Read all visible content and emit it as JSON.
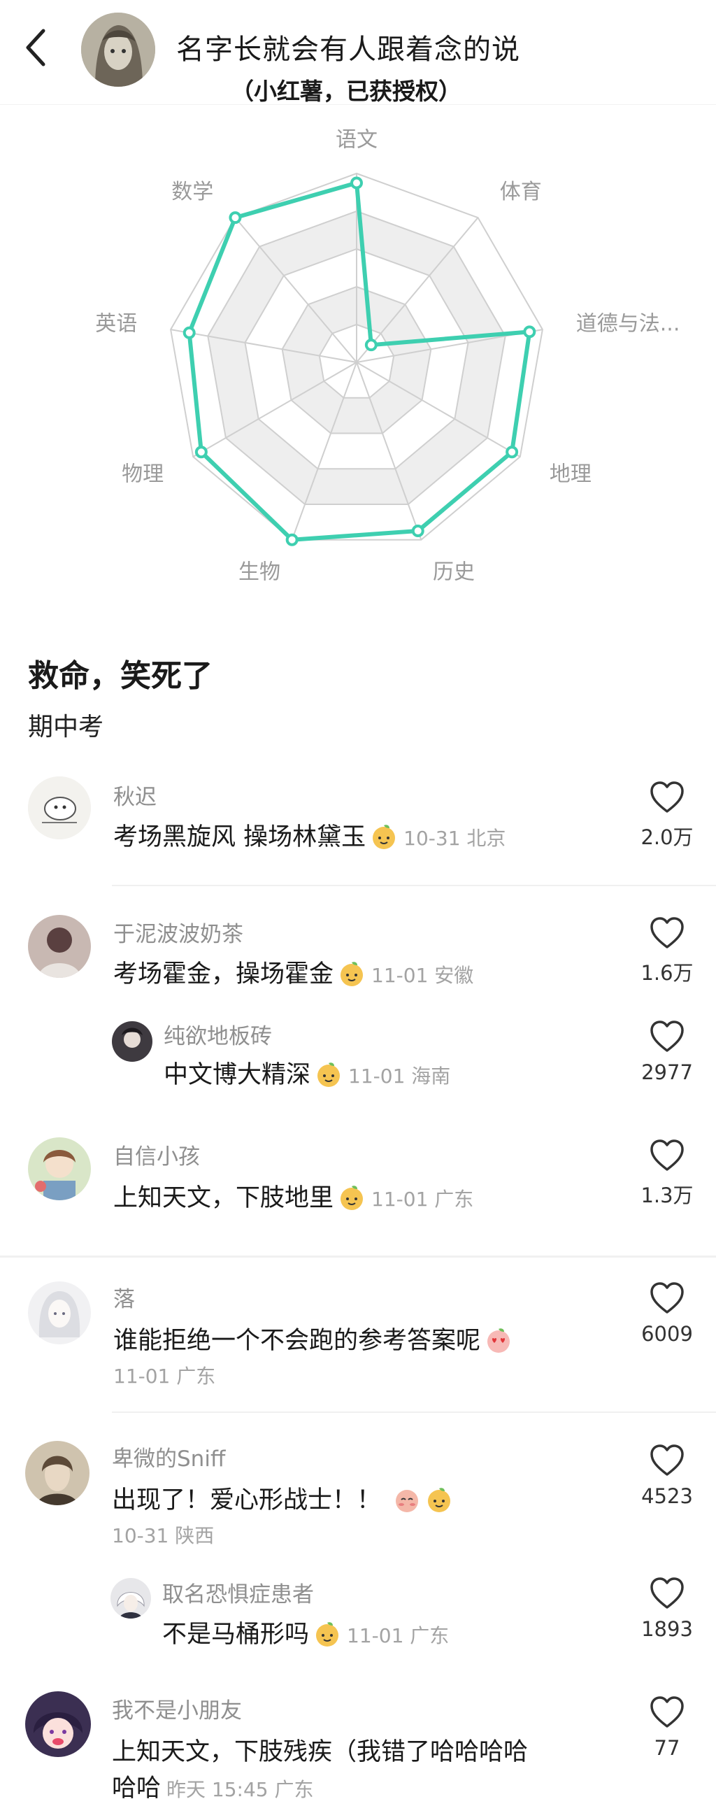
{
  "header": {
    "back_icon": "chevron-left-icon",
    "title": "名字长就会有人跟着念的说",
    "subtitle": "（小红薯，已获授权）"
  },
  "radar": {
    "axes": [
      "语文",
      "体育",
      "道德与法...",
      "地理",
      "历史",
      "生物",
      "物理",
      "英语",
      "数学"
    ],
    "values": [
      0.95,
      0.12,
      0.93,
      0.95,
      0.95,
      1.0,
      0.95,
      0.9,
      1.0
    ],
    "line_color": "#3ecfb0",
    "grid_color": "#cfcfcf",
    "band_color": "#eeeeee"
  },
  "post": {
    "title": "救命，笑死了",
    "body": "期中考"
  },
  "comments": [
    {
      "name": "秋迟",
      "text": "考场黑旋风 操场林黛玉",
      "meta": "10-31 北京",
      "likes": "2.0万",
      "emoji": "peach-face-emoji"
    },
    {
      "name": "于泥波波奶茶",
      "text": "考场霍金，操场霍金",
      "meta": "11-01 安徽",
      "likes": "1.6万",
      "emoji": "peach-face-emoji"
    },
    {
      "name": "纯欲地板砖",
      "text": "中文博大精深",
      "meta": "11-01 海南",
      "likes": "2977",
      "emoji": "peach-face-emoji"
    },
    {
      "name": "自信小孩",
      "text": "上知天文，下肢地里",
      "meta": "11-01 广东",
      "likes": "1.3万",
      "emoji": "peach-face-emoji"
    },
    {
      "name": "落",
      "text": "谁能拒绝一个不会跑的参考答案呢",
      "meta": "11-01 广东",
      "likes": "6009",
      "emoji": "heart-eyes-emoji"
    },
    {
      "name": "卑微的Sniff",
      "text": "出现了！爱心形战士！！",
      "meta": "10-31 陕西",
      "likes": "4523",
      "emoji": "blush-face-emoji"
    },
    {
      "name": "取名恐惧症患者",
      "text": "不是马桶形吗",
      "meta": "11-01 广东",
      "likes": "1893",
      "emoji": "peach-face-emoji"
    },
    {
      "name": "我不是小朋友",
      "text": "上知天文，下肢残疾（我错了哈哈哈哈",
      "text2": "哈哈",
      "meta": "昨天 15:45 广东",
      "likes": "77",
      "emoji": ""
    }
  ]
}
